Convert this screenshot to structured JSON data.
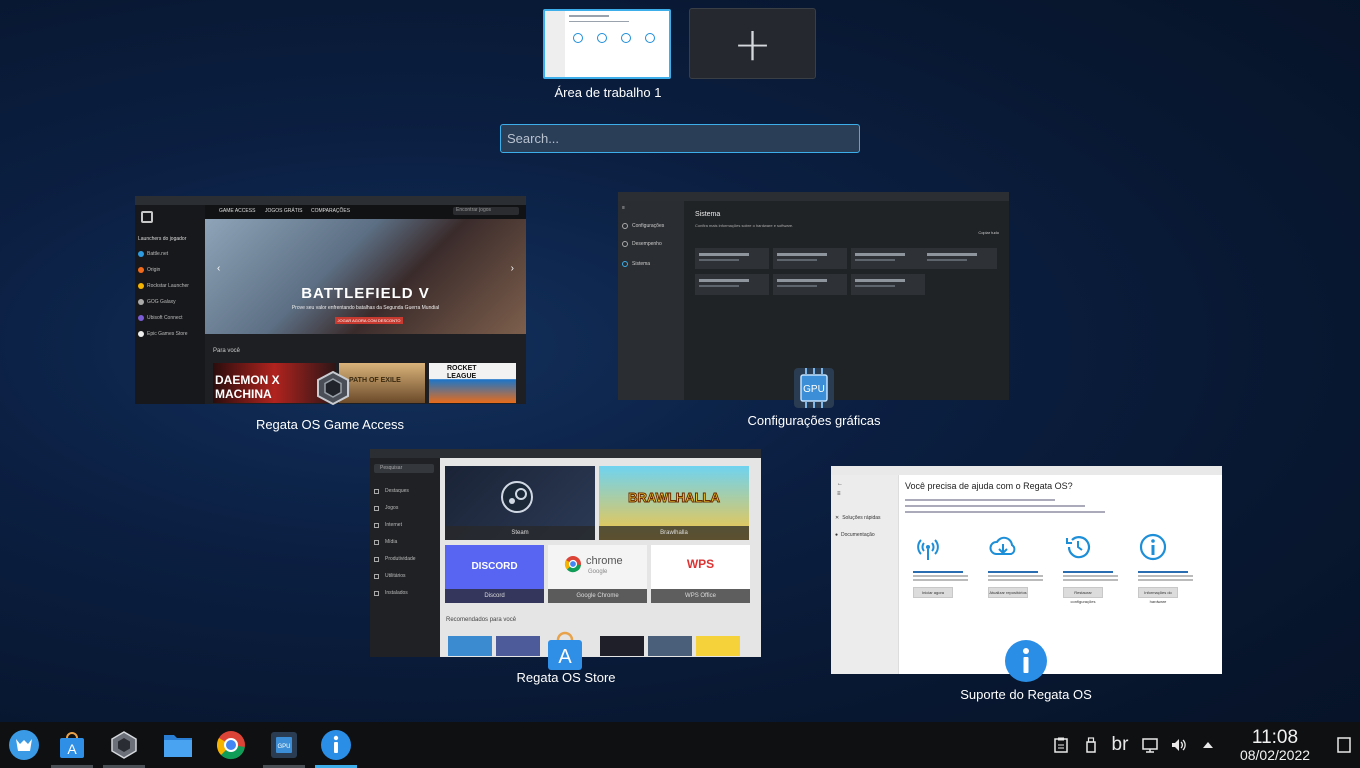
{
  "desktops": {
    "current_label": "Área de trabalho 1",
    "add_icon": "plus-icon"
  },
  "search": {
    "placeholder": "Search..."
  },
  "windows": [
    {
      "title": "Regata OS Game Access",
      "thumb": {
        "tabs": [
          "GAME ACCESS",
          "JOGOS GRÁTIS",
          "COMPARAÇÕES"
        ],
        "search_placeholder": "Encontrar jogos",
        "library_heading": "Launchers do jogador",
        "launchers": [
          "Battle.net",
          "Origin",
          "Rockstar Launcher",
          "GOG Galaxy",
          "Ubisoft Connect",
          "Epic Games Store"
        ],
        "hero_title": "BATTLEFIELD V",
        "hero_subtitle": "Prove seu valor enfrentando batalhas da Segunda Guerra Mundial",
        "hero_button": "JOGAR AGORA COM DESCONTO",
        "section": "Para você",
        "games": [
          "DAEMON X MACHINA",
          "PATH OF EXILE",
          "ROCKET LEAGUE"
        ]
      }
    },
    {
      "title": "Configurações gráficas",
      "thumb": {
        "sidebar": [
          "Configurações",
          "Desempenho",
          "Sistema"
        ],
        "heading": "Sistema",
        "subheading": "Confira mais informações sobre o hardware e software.",
        "copy_btn": "Copiar tudo"
      }
    },
    {
      "title": "Regata OS Store",
      "thumb": {
        "search": "Pesquisar",
        "sidebar": [
          "Destaques",
          "Jogos",
          "Internet",
          "Mídia",
          "Produtividade",
          "Utilitários",
          "Instalados"
        ],
        "tiles": [
          "Steam",
          "Brawlhalla",
          "Discord",
          "Google Chrome",
          "WPS Office"
        ],
        "tile_logos": [
          "BRAWLHALLA",
          "DISCORD",
          "chrome",
          "Google",
          "WPS"
        ],
        "recommend": "Recomendados para você"
      }
    },
    {
      "title": "Suporte do Regata OS",
      "thumb": {
        "sidebar": [
          "Soluções rápidas",
          "Documentação"
        ],
        "heading": "Você precisa de ajuda com o Regata OS?",
        "buttons": [
          "Iniciar agora",
          "Atualizar repositórios",
          "Restaurar configurações",
          "Informações do hardware"
        ]
      }
    }
  ],
  "taskbar": {
    "apps": [
      "regata-menu-icon",
      "store-icon",
      "game-access-icon",
      "file-manager-icon",
      "chrome-icon",
      "gpu-settings-icon",
      "support-icon"
    ],
    "keyboard_layout": "br",
    "time": "11:08",
    "date": "08/02/2022"
  },
  "colors": {
    "accent": "#3daee9",
    "panel": "#0f1012"
  }
}
